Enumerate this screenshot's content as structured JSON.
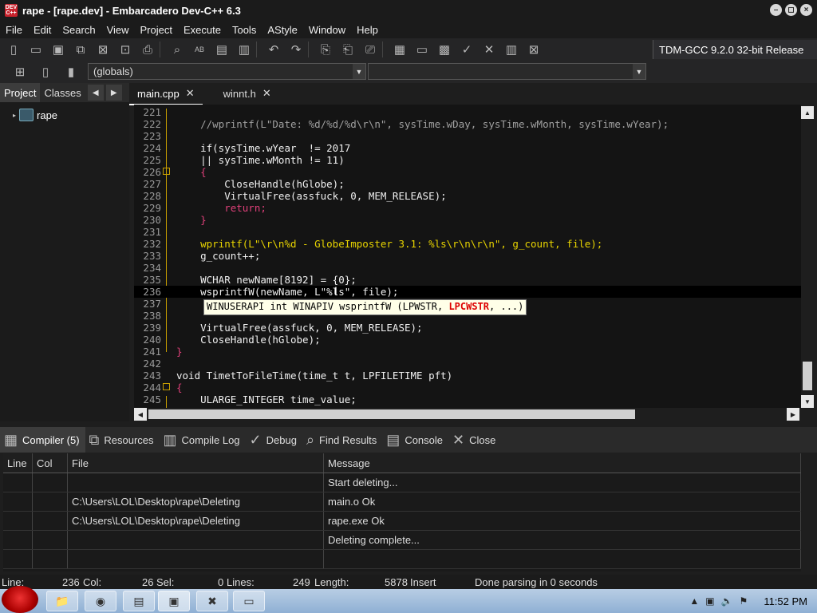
{
  "window": {
    "title": "rape - [rape.dev] - Embarcadero Dev-C++ 6.3",
    "app_icon_text": "DEV C++"
  },
  "menu": [
    "File",
    "Edit",
    "Search",
    "View",
    "Project",
    "Execute",
    "Tools",
    "AStyle",
    "Window",
    "Help"
  ],
  "toolbar": {
    "compiler": "TDM-GCC 9.2.0 32-bit Release",
    "globals": "(globals)"
  },
  "left_panel": {
    "tabs": [
      "Project",
      "Classes"
    ],
    "tree_root": "rape"
  },
  "editor_tabs": [
    {
      "label": "main.cpp",
      "active": true
    },
    {
      "label": "winnt.h",
      "active": false
    }
  ],
  "code_lines": [
    {
      "n": "221",
      "text": ""
    },
    {
      "n": "222",
      "text": "    //wprintf(L\"Date: %d/%d/%d\\r\\n\", sysTime.wDay, sysTime.wMonth, sysTime.wYear);"
    },
    {
      "n": "223",
      "text": ""
    },
    {
      "n": "224",
      "text": "    if(sysTime.wYear  != 2017"
    },
    {
      "n": "225",
      "text": "    || sysTime.wMonth != 11)"
    },
    {
      "n": "226",
      "text": "    {"
    },
    {
      "n": "227",
      "text": "        CloseHandle(hGlobe);"
    },
    {
      "n": "228",
      "text": "        VirtualFree(assfuck, 0, MEM_RELEASE);"
    },
    {
      "n": "229",
      "text": "        return;"
    },
    {
      "n": "230",
      "text": "    }"
    },
    {
      "n": "231",
      "text": ""
    },
    {
      "n": "232",
      "text": "    wprintf(L\"\\r\\n%d - GlobeImposter 3.1: %ls\\r\\n\\r\\n\", g_count, file);"
    },
    {
      "n": "233",
      "text": "    g_count++;"
    },
    {
      "n": "234",
      "text": ""
    },
    {
      "n": "235",
      "text": "    WCHAR newName[8192] = {0};"
    },
    {
      "n": "236",
      "text": "    wsprintfW(newName, L\"%ls\", file);"
    },
    {
      "n": "237",
      "text": ""
    },
    {
      "n": "238",
      "text": ""
    },
    {
      "n": "239",
      "text": "    VirtualFree(assfuck, 0, MEM_RELEASE);"
    },
    {
      "n": "240",
      "text": "    CloseHandle(hGlobe);"
    },
    {
      "n": "241",
      "text": "}"
    },
    {
      "n": "242",
      "text": ""
    },
    {
      "n": "243",
      "text": "void TimetToFileTime(time_t t, LPFILETIME pft)"
    },
    {
      "n": "244",
      "text": "{"
    },
    {
      "n": "245",
      "text": "    ULARGE_INTEGER time_value;"
    }
  ],
  "tooltip": {
    "prefix": "WINUSERAPI int WINAPIV wsprintfW (LPWSTR, ",
    "bold": "LPCWSTR",
    "suffix": ", ...)"
  },
  "bottom_tabs": [
    "Compiler (5)",
    "Resources",
    "Compile Log",
    "Debug",
    "Find Results",
    "Console",
    "Close"
  ],
  "messages": {
    "headers": [
      "Line",
      "Col",
      "File",
      "Message"
    ],
    "rows": [
      {
        "line": "",
        "col": "",
        "file": "",
        "message": "Start deleting..."
      },
      {
        "line": "",
        "col": "",
        "file": "C:\\Users\\LOL\\Desktop\\rape\\Deleting",
        "message": "main.o Ok"
      },
      {
        "line": "",
        "col": "",
        "file": "C:\\Users\\LOL\\Desktop\\rape\\Deleting",
        "message": "rape.exe Ok"
      },
      {
        "line": "",
        "col": "",
        "file": "",
        "message": "Deleting complete..."
      },
      {
        "line": "",
        "col": "",
        "file": "",
        "message": ""
      }
    ]
  },
  "status": {
    "line_label": "Line:",
    "line_val": "236",
    "col_label": "Col:",
    "col_val": "26",
    "sel_label": "Sel:",
    "sel_val": "0",
    "lines_label": "Lines:",
    "lines_val": "249",
    "length_label": "Length:",
    "length_val": "5878",
    "mode": "Insert",
    "parse": "Done parsing in 0 seconds"
  },
  "taskbar": {
    "clock": "11:52 PM"
  }
}
